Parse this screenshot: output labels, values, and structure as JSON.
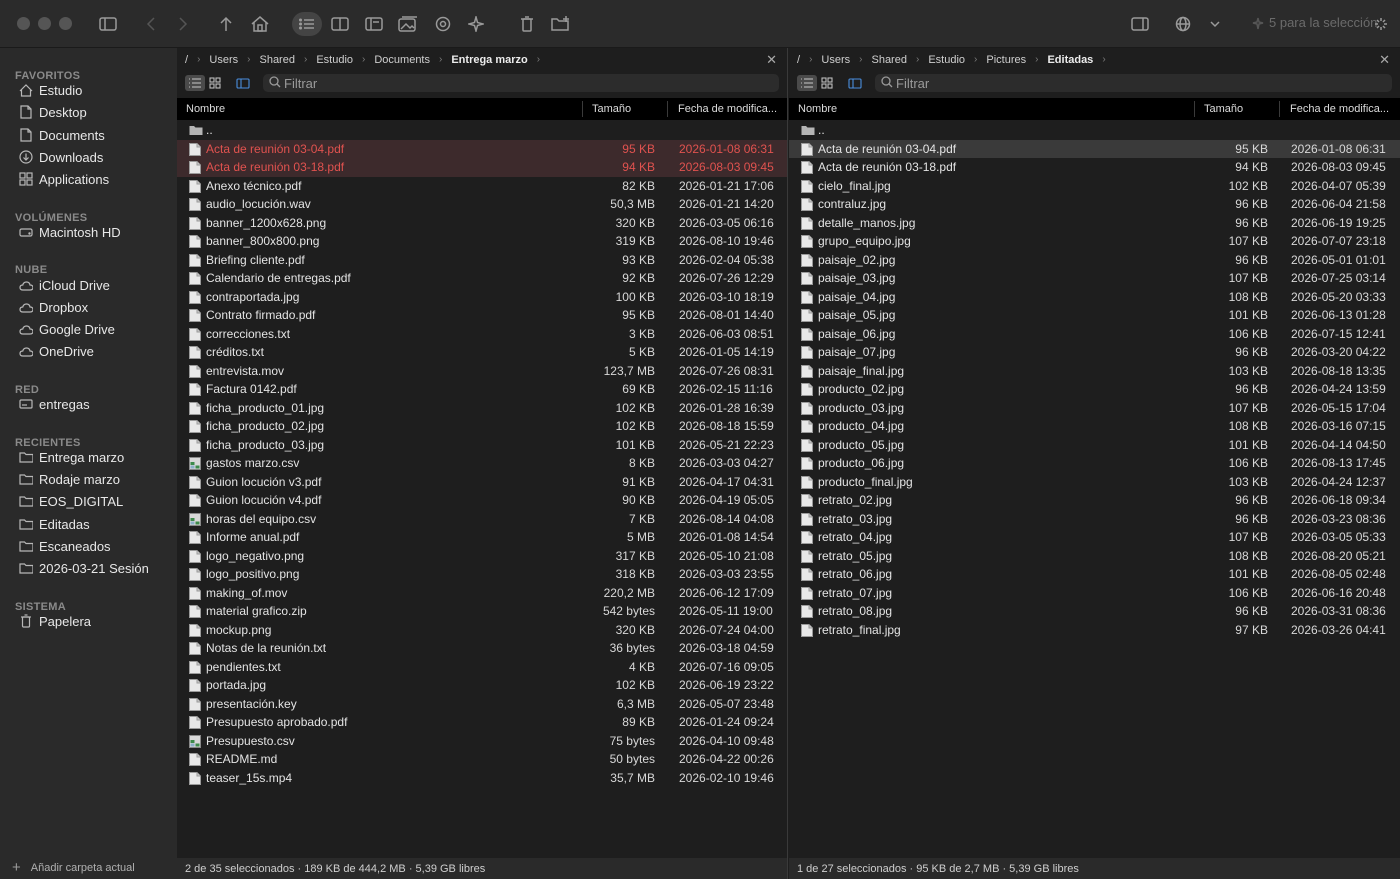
{
  "toolbar": {
    "selection_status": "5 para la selección"
  },
  "sidebar": {
    "sections": [
      {
        "title": "FAVORITOS",
        "items": [
          {
            "label": "Estudio",
            "icon": "home-icon"
          },
          {
            "label": "Desktop",
            "icon": "document-icon"
          },
          {
            "label": "Documents",
            "icon": "document-icon"
          },
          {
            "label": "Downloads",
            "icon": "download-icon"
          },
          {
            "label": "Applications",
            "icon": "apps-icon"
          }
        ]
      },
      {
        "title": "VOLÚMENES",
        "items": [
          {
            "label": "Macintosh HD",
            "icon": "drive-icon"
          }
        ]
      },
      {
        "title": "NUBE",
        "items": [
          {
            "label": "iCloud Drive",
            "icon": "cloud-icon"
          },
          {
            "label": "Dropbox",
            "icon": "cloud-icon"
          },
          {
            "label": "Google Drive",
            "icon": "cloud-icon"
          },
          {
            "label": "OneDrive",
            "icon": "cloud-icon"
          }
        ]
      },
      {
        "title": "RED",
        "items": [
          {
            "label": "entregas",
            "icon": "network-drive-icon"
          }
        ]
      },
      {
        "title": "RECIENTES",
        "items": [
          {
            "label": "Entrega marzo",
            "icon": "folder-icon"
          },
          {
            "label": "Rodaje marzo",
            "icon": "folder-icon"
          },
          {
            "label": "EOS_DIGITAL",
            "icon": "folder-icon"
          },
          {
            "label": "Editadas",
            "icon": "folder-icon"
          },
          {
            "label": "Escaneados",
            "icon": "folder-icon"
          },
          {
            "label": "2026-03-21 Sesión",
            "icon": "folder-icon"
          }
        ]
      },
      {
        "title": "SISTEMA",
        "items": [
          {
            "label": "Papelera",
            "icon": "trash-icon"
          }
        ]
      }
    ],
    "footer_label": "Añadir carpeta actual"
  },
  "left_pane": {
    "breadcrumb": [
      "/",
      "Users",
      "Shared",
      "Estudio",
      "Documents",
      "Entrega marzo"
    ],
    "filter_placeholder": "Filtrar",
    "columns": {
      "name": "Nombre",
      "size": "Tamaño",
      "date": "Fecha de modifica..."
    },
    "parent": "..",
    "files": [
      {
        "name": "Acta de reunión 03-04.pdf",
        "size": "95 KB",
        "date": "2026-01-08 06:31",
        "state": "selected-red",
        "icon": "file-icon"
      },
      {
        "name": "Acta de reunión 03-18.pdf",
        "size": "94 KB",
        "date": "2026-08-03 09:45",
        "state": "selected-red",
        "icon": "file-icon"
      },
      {
        "name": "Anexo técnico.pdf",
        "size": "82 KB",
        "date": "2026-01-21 17:06",
        "state": "",
        "icon": "file-icon"
      },
      {
        "name": "audio_locución.wav",
        "size": "50,3 MB",
        "date": "2026-01-21 14:20",
        "state": "",
        "icon": "file-icon"
      },
      {
        "name": "banner_1200x628.png",
        "size": "320 KB",
        "date": "2026-03-05 06:16",
        "state": "",
        "icon": "file-icon"
      },
      {
        "name": "banner_800x800.png",
        "size": "319 KB",
        "date": "2026-08-10 19:46",
        "state": "",
        "icon": "file-icon"
      },
      {
        "name": "Briefing cliente.pdf",
        "size": "93 KB",
        "date": "2026-02-04 05:38",
        "state": "",
        "icon": "file-icon"
      },
      {
        "name": "Calendario de entregas.pdf",
        "size": "92 KB",
        "date": "2026-07-26 12:29",
        "state": "",
        "icon": "file-icon"
      },
      {
        "name": "contraportada.jpg",
        "size": "100 KB",
        "date": "2026-03-10 18:19",
        "state": "",
        "icon": "file-icon"
      },
      {
        "name": "Contrato firmado.pdf",
        "size": "95 KB",
        "date": "2026-08-01 14:40",
        "state": "",
        "icon": "file-icon"
      },
      {
        "name": "correcciones.txt",
        "size": "3 KB",
        "date": "2026-06-03 08:51",
        "state": "",
        "icon": "file-icon"
      },
      {
        "name": "créditos.txt",
        "size": "5 KB",
        "date": "2026-01-05 14:19",
        "state": "",
        "icon": "file-icon"
      },
      {
        "name": "entrevista.mov",
        "size": "123,7 MB",
        "date": "2026-07-26 08:31",
        "state": "",
        "icon": "file-icon"
      },
      {
        "name": "Factura 0142.pdf",
        "size": "69 KB",
        "date": "2026-02-15 11:16",
        "state": "",
        "icon": "file-icon"
      },
      {
        "name": "ficha_producto_01.jpg",
        "size": "102 KB",
        "date": "2026-01-28 16:39",
        "state": "",
        "icon": "file-icon"
      },
      {
        "name": "ficha_producto_02.jpg",
        "size": "102 KB",
        "date": "2026-08-18 15:59",
        "state": "",
        "icon": "file-icon"
      },
      {
        "name": "ficha_producto_03.jpg",
        "size": "101 KB",
        "date": "2026-05-21 22:23",
        "state": "",
        "icon": "file-icon"
      },
      {
        "name": "gastos marzo.csv",
        "size": "8 KB",
        "date": "2026-03-03 04:27",
        "state": "",
        "icon": "spreadsheet-icon"
      },
      {
        "name": "Guion locución v3.pdf",
        "size": "91 KB",
        "date": "2026-04-17 04:31",
        "state": "",
        "icon": "file-icon"
      },
      {
        "name": "Guion locución v4.pdf",
        "size": "90 KB",
        "date": "2026-04-19 05:05",
        "state": "",
        "icon": "file-icon"
      },
      {
        "name": "horas del equipo.csv",
        "size": "7 KB",
        "date": "2026-08-14 04:08",
        "state": "",
        "icon": "spreadsheet-icon"
      },
      {
        "name": "Informe anual.pdf",
        "size": "5 MB",
        "date": "2026-01-08 14:54",
        "state": "",
        "icon": "file-icon"
      },
      {
        "name": "logo_negativo.png",
        "size": "317 KB",
        "date": "2026-05-10 21:08",
        "state": "",
        "icon": "file-icon"
      },
      {
        "name": "logo_positivo.png",
        "size": "318 KB",
        "date": "2026-03-03 23:55",
        "state": "",
        "icon": "file-icon"
      },
      {
        "name": "making_of.mov",
        "size": "220,2 MB",
        "date": "2026-06-12 17:09",
        "state": "",
        "icon": "file-icon"
      },
      {
        "name": "material grafico.zip",
        "size": "542 bytes",
        "date": "2026-05-11 19:00",
        "state": "",
        "icon": "file-icon"
      },
      {
        "name": "mockup.png",
        "size": "320 KB",
        "date": "2026-07-24 04:00",
        "state": "",
        "icon": "file-icon"
      },
      {
        "name": "Notas de la reunión.txt",
        "size": "36 bytes",
        "date": "2026-03-18 04:59",
        "state": "",
        "icon": "file-icon"
      },
      {
        "name": "pendientes.txt",
        "size": "4 KB",
        "date": "2026-07-16 09:05",
        "state": "",
        "icon": "file-icon"
      },
      {
        "name": "portada.jpg",
        "size": "102 KB",
        "date": "2026-06-19 23:22",
        "state": "",
        "icon": "file-icon"
      },
      {
        "name": "presentación.key",
        "size": "6,3 MB",
        "date": "2026-05-07 23:48",
        "state": "",
        "icon": "file-icon"
      },
      {
        "name": "Presupuesto aprobado.pdf",
        "size": "89 KB",
        "date": "2026-01-24 09:24",
        "state": "",
        "icon": "file-icon"
      },
      {
        "name": "Presupuesto.csv",
        "size": "75 bytes",
        "date": "2026-04-10 09:48",
        "state": "",
        "icon": "spreadsheet-icon"
      },
      {
        "name": "README.md",
        "size": "50 bytes",
        "date": "2026-04-22 00:26",
        "state": "",
        "icon": "file-icon"
      },
      {
        "name": "teaser_15s.mp4",
        "size": "35,7 MB",
        "date": "2026-02-10 19:46",
        "state": "",
        "icon": "file-icon"
      }
    ],
    "status": "2 de 35 seleccionados · 189 KB de 444,2 MB · 5,39 GB libres"
  },
  "right_pane": {
    "breadcrumb": [
      "/",
      "Users",
      "Shared",
      "Estudio",
      "Pictures",
      "Editadas"
    ],
    "filter_placeholder": "Filtrar",
    "columns": {
      "name": "Nombre",
      "size": "Tamaño",
      "date": "Fecha de modifica..."
    },
    "parent": "..",
    "files": [
      {
        "name": "Acta de reunión 03-04.pdf",
        "size": "95 KB",
        "date": "2026-01-08 06:31",
        "state": "selected",
        "icon": "file-icon"
      },
      {
        "name": "Acta de reunión 03-18.pdf",
        "size": "94 KB",
        "date": "2026-08-03 09:45",
        "state": "",
        "icon": "file-icon"
      },
      {
        "name": "cielo_final.jpg",
        "size": "102 KB",
        "date": "2026-04-07 05:39",
        "state": "",
        "icon": "file-icon"
      },
      {
        "name": "contraluz.jpg",
        "size": "96 KB",
        "date": "2026-06-04 21:58",
        "state": "",
        "icon": "file-icon"
      },
      {
        "name": "detalle_manos.jpg",
        "size": "96 KB",
        "date": "2026-06-19 19:25",
        "state": "",
        "icon": "file-icon"
      },
      {
        "name": "grupo_equipo.jpg",
        "size": "107 KB",
        "date": "2026-07-07 23:18",
        "state": "",
        "icon": "file-icon"
      },
      {
        "name": "paisaje_02.jpg",
        "size": "96 KB",
        "date": "2026-05-01 01:01",
        "state": "",
        "icon": "file-icon"
      },
      {
        "name": "paisaje_03.jpg",
        "size": "107 KB",
        "date": "2026-07-25 03:14",
        "state": "",
        "icon": "file-icon"
      },
      {
        "name": "paisaje_04.jpg",
        "size": "108 KB",
        "date": "2026-05-20 03:33",
        "state": "",
        "icon": "file-icon"
      },
      {
        "name": "paisaje_05.jpg",
        "size": "101 KB",
        "date": "2026-06-13 01:28",
        "state": "",
        "icon": "file-icon"
      },
      {
        "name": "paisaje_06.jpg",
        "size": "106 KB",
        "date": "2026-07-15 12:41",
        "state": "",
        "icon": "file-icon"
      },
      {
        "name": "paisaje_07.jpg",
        "size": "96 KB",
        "date": "2026-03-20 04:22",
        "state": "",
        "icon": "file-icon"
      },
      {
        "name": "paisaje_final.jpg",
        "size": "103 KB",
        "date": "2026-08-18 13:35",
        "state": "",
        "icon": "file-icon"
      },
      {
        "name": "producto_02.jpg",
        "size": "96 KB",
        "date": "2026-04-24 13:59",
        "state": "",
        "icon": "file-icon"
      },
      {
        "name": "producto_03.jpg",
        "size": "107 KB",
        "date": "2026-05-15 17:04",
        "state": "",
        "icon": "file-icon"
      },
      {
        "name": "producto_04.jpg",
        "size": "108 KB",
        "date": "2026-03-16 07:15",
        "state": "",
        "icon": "file-icon"
      },
      {
        "name": "producto_05.jpg",
        "size": "101 KB",
        "date": "2026-04-14 04:50",
        "state": "",
        "icon": "file-icon"
      },
      {
        "name": "producto_06.jpg",
        "size": "106 KB",
        "date": "2026-08-13 17:45",
        "state": "",
        "icon": "file-icon"
      },
      {
        "name": "producto_final.jpg",
        "size": "103 KB",
        "date": "2026-04-24 12:37",
        "state": "",
        "icon": "file-icon"
      },
      {
        "name": "retrato_02.jpg",
        "size": "96 KB",
        "date": "2026-06-18 09:34",
        "state": "",
        "icon": "file-icon"
      },
      {
        "name": "retrato_03.jpg",
        "size": "96 KB",
        "date": "2026-03-23 08:36",
        "state": "",
        "icon": "file-icon"
      },
      {
        "name": "retrato_04.jpg",
        "size": "107 KB",
        "date": "2026-03-05 05:33",
        "state": "",
        "icon": "file-icon"
      },
      {
        "name": "retrato_05.jpg",
        "size": "108 KB",
        "date": "2026-08-20 05:21",
        "state": "",
        "icon": "file-icon"
      },
      {
        "name": "retrato_06.jpg",
        "size": "101 KB",
        "date": "2026-08-05 02:48",
        "state": "",
        "icon": "file-icon"
      },
      {
        "name": "retrato_07.jpg",
        "size": "106 KB",
        "date": "2026-06-16 20:48",
        "state": "",
        "icon": "file-icon"
      },
      {
        "name": "retrato_08.jpg",
        "size": "96 KB",
        "date": "2026-03-31 08:36",
        "state": "",
        "icon": "file-icon"
      },
      {
        "name": "retrato_final.jpg",
        "size": "97 KB",
        "date": "2026-03-26 04:41",
        "state": "",
        "icon": "file-icon"
      }
    ],
    "status": "1 de 27 seleccionados · 95 KB de 2,7 MB · 5,39 GB libres"
  },
  "colors": {
    "selection_red_text": "#e0524f",
    "selection_red_bg": "#3d2a2c",
    "selection_gray_bg": "#3a3a3a",
    "accent_blue": "#4a8fe0"
  }
}
